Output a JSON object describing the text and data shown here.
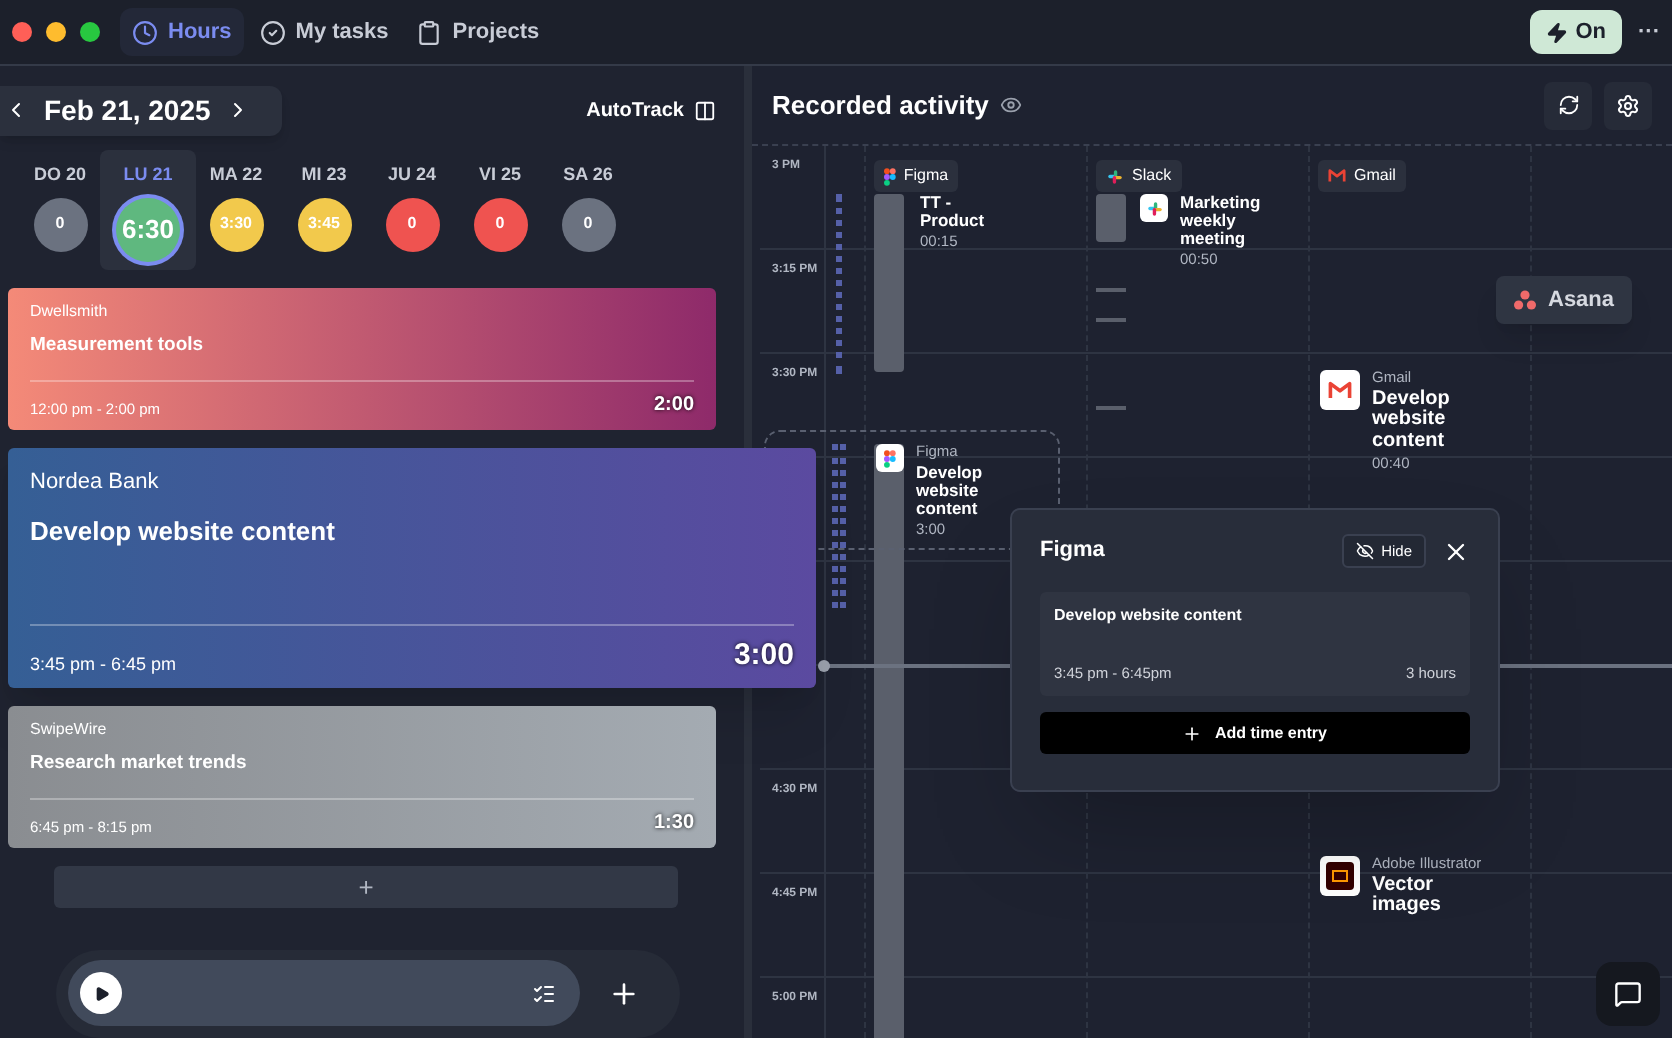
{
  "tabs": [
    {
      "label": "Hours",
      "selected": true
    },
    {
      "label": "My tasks",
      "selected": false
    },
    {
      "label": "Projects",
      "selected": false
    }
  ],
  "autotrack_toggle": {
    "label": "On",
    "on": true
  },
  "more_menu": "···",
  "date_picker": {
    "date": "Feb 21, 2025"
  },
  "autotrack_link": "AutoTrack",
  "days": [
    {
      "weekday": "DO",
      "date": "20",
      "total": "0",
      "color": "#6b7280",
      "selected": false
    },
    {
      "weekday": "LU",
      "date": "21",
      "total": "6:30",
      "color": "#5fb87f",
      "selected": true
    },
    {
      "weekday": "MA",
      "date": "22",
      "total": "3:30",
      "color": "#f2c94c",
      "selected": false
    },
    {
      "weekday": "MI",
      "date": "23",
      "total": "3:45",
      "color": "#f2c94c",
      "selected": false
    },
    {
      "weekday": "JU",
      "date": "24",
      "total": "0",
      "color": "#ef5350",
      "selected": false
    },
    {
      "weekday": "VI",
      "date": "25",
      "total": "0",
      "color": "#ef5350",
      "selected": false
    },
    {
      "weekday": "SA",
      "date": "26",
      "total": "0",
      "color": "#6b7280",
      "selected": false
    }
  ],
  "entries": [
    {
      "client": "Dwellsmith",
      "title": "Measurement tools",
      "time_range": "12:00 pm - 2:00 pm",
      "duration": "2:00",
      "color": "#f48a78",
      "selected": false
    },
    {
      "client": "Nordea Bank",
      "title": "Develop website content",
      "time_range": "3:45 pm - 6:45 pm",
      "duration": "3:00",
      "color": "#355f95",
      "selected": true
    },
    {
      "client": "SwipeWire",
      "title": "Research market trends",
      "time_range": "6:45 pm - 8:15 pm",
      "duration": "1:30",
      "color": "#8a8d91",
      "selected": false
    }
  ],
  "add_entry": "+",
  "recorded_activity": {
    "title": "Recorded activity",
    "time_labels": [
      "3 PM",
      "3:15 PM",
      "3:30 PM",
      "4:30 PM",
      "4:45 PM",
      "5:00 PM"
    ],
    "app_columns": [
      {
        "name": "Figma",
        "kind": "figma"
      },
      {
        "name": "Slack",
        "kind": "slack"
      },
      {
        "name": "Gmail",
        "kind": "gmail"
      }
    ],
    "activities": [
      {
        "kind": "plain",
        "title": "TT - Product",
        "duration": "00:15"
      },
      {
        "kind": "slack",
        "title": "Marketing weekly meeting",
        "duration": "00:50"
      },
      {
        "kind": "gmail",
        "app_name": "Gmail",
        "title": "Develop website content",
        "duration": "00:40"
      },
      {
        "kind": "figma",
        "app_name": "Figma",
        "title": "Develop website content",
        "duration": "3:00"
      },
      {
        "kind": "illustrator",
        "app_name": "Adobe Illustrator",
        "title": "Vector images"
      }
    ],
    "floating_app": "Asana",
    "popup": {
      "title": "Figma",
      "hide": "Hide",
      "task": "Develop website content",
      "time_range": "3:45 pm - 6:45pm",
      "duration": "3 hours",
      "action": "Add time entry"
    }
  }
}
